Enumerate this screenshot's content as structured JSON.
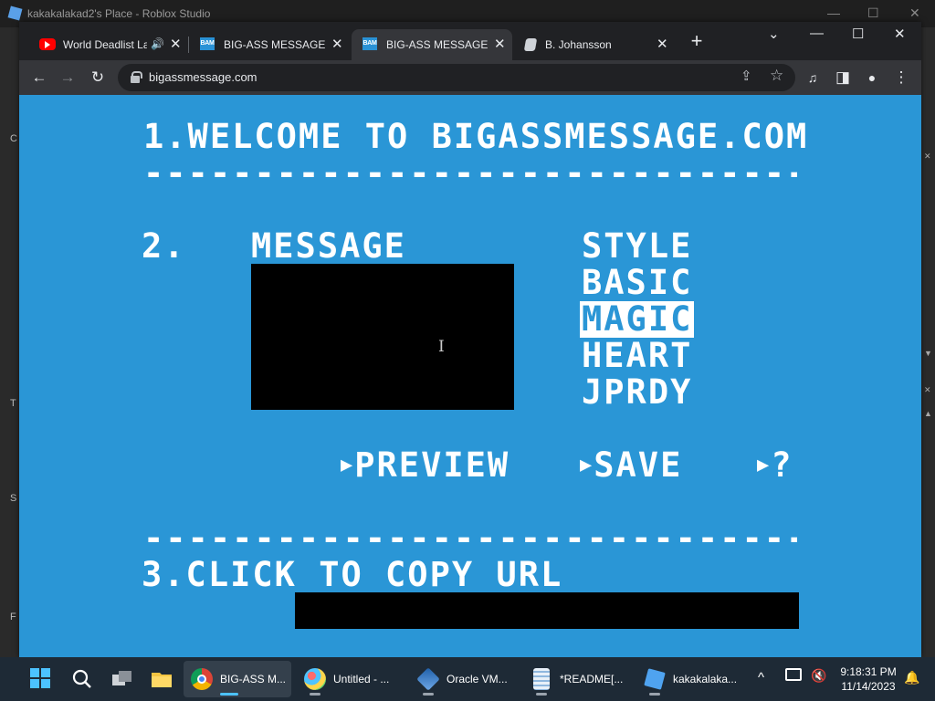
{
  "background_window": {
    "title": "kakakalakad2's Place - Roblox Studio",
    "left_letters": [
      "C",
      "T",
      "S",
      "F"
    ],
    "minimize": "—",
    "maximize": "☐",
    "close": "✕"
  },
  "browser": {
    "tabs": [
      {
        "favicon": "youtube-icon",
        "label": "World Deadlist La",
        "audio": "🔊",
        "close": "✕",
        "active": false
      },
      {
        "favicon": "bam-icon",
        "favicon_text": "BAM",
        "label": "BIG-ASS MESSAGE",
        "close": "✕",
        "active": false
      },
      {
        "favicon": "bam-icon",
        "favicon_text": "BAM",
        "label": "BIG-ASS MESSAGE",
        "close": "✕",
        "active": true
      },
      {
        "favicon": "chat-icon",
        "label": "B. Johansson",
        "close": "✕",
        "active": false
      }
    ],
    "new_tab": "+",
    "window_controls": {
      "tab_search": "⌄",
      "minimize": "—",
      "maximize": "☐",
      "close": "✕"
    },
    "nav": {
      "back": "←",
      "forward": "→",
      "reload": "↻"
    },
    "address": {
      "url": "bigassmessage.com",
      "share_icon": "⇪",
      "star_icon": "☆"
    },
    "toolbar_icons": {
      "media": "♫",
      "sidepanel": "◨",
      "profile": "●",
      "menu": "⋮"
    }
  },
  "page": {
    "heading": "1.WELCOME TO BIGASSMESSAGE.COM",
    "divider": "------------------------------",
    "step2": "2.",
    "message_label": "MESSAGE",
    "message_value": "",
    "style_label": "STYLE",
    "styles": [
      "BASIC",
      "MAGIC",
      "HEART",
      "JPRDY"
    ],
    "selected_style": "MAGIC",
    "preview_label": "PREVIEW",
    "save_label": "SAVE",
    "help_label": "?",
    "arrow": "▶",
    "step3": "3.CLICK TO COPY URL",
    "url_value": ""
  },
  "taskbar": {
    "apps": [
      {
        "name": "BIG-ASS M...",
        "icon": "chrome-icon",
        "active": true
      },
      {
        "name": "Untitled - ...",
        "icon": "paint-icon",
        "active": false
      },
      {
        "name": "Oracle VM...",
        "icon": "virtualbox-icon",
        "active": false
      },
      {
        "name": "*README[...",
        "icon": "notepad-icon",
        "active": false
      },
      {
        "name": "kakakalaka...",
        "icon": "roblox-icon",
        "active": false
      }
    ],
    "tray_chevron": "^",
    "time": "9:18:31 PM",
    "date": "11/14/2023"
  }
}
